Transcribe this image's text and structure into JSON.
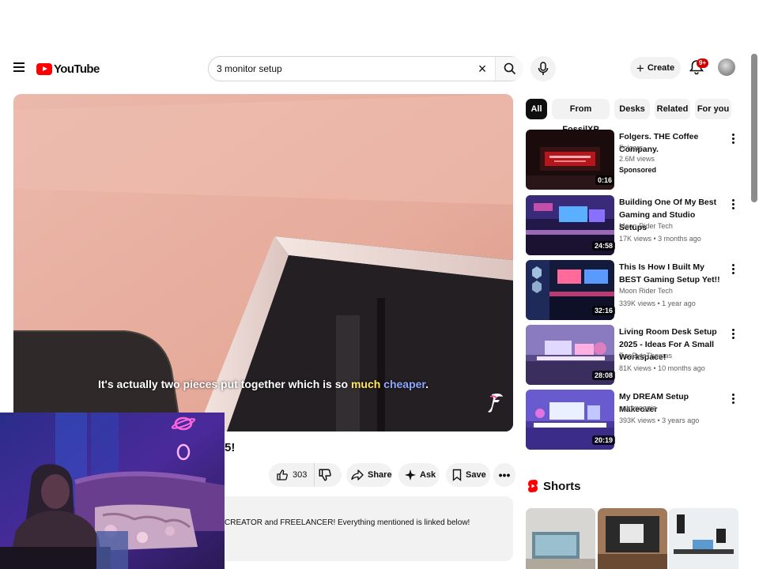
{
  "header": {
    "logo_text": "YouTube",
    "search_value": "3 monitor setup",
    "create_label": "Create",
    "notification_count": "9+"
  },
  "player": {
    "caption_parts": [
      "It's actually two pieces put together which is so ",
      "much",
      " ",
      "cheaper",
      "."
    ]
  },
  "video": {
    "title_fragment": "5!",
    "like_count": "303",
    "share_label": "Share",
    "ask_label": "Ask",
    "save_label": "Save",
    "description": "CREATOR and FREELANCER! Everything mentioned is linked below!"
  },
  "chips": [
    "All",
    "From FossilXP",
    "Desks",
    "Related",
    "For you"
  ],
  "recommendations": [
    {
      "title": "Folgers. THE Coffee Company.",
      "channel": "Folgers",
      "meta": "2.6M views",
      "badge": "Sponsored",
      "duration": "0:16"
    },
    {
      "title": "Building One Of My Best Gaming and Studio Setups",
      "channel": "Moon Rider Tech",
      "meta": "17K views • 3 months ago",
      "duration": "24:58"
    },
    {
      "title": "This Is How I Built My BEST Gaming Setup Yet!!",
      "channel": "Moon Rider Tech",
      "meta": "339K views • 1 year ago",
      "duration": "32:16"
    },
    {
      "title": "Living Room Desk Setup 2025 - Ideas For A Small Workspace!",
      "channel": "TwoByteThomas",
      "meta": "81K views • 10 months ago",
      "duration": "28:08"
    },
    {
      "title": "My DREAM Setup Makeover",
      "channel": "astronoggie",
      "meta": "393K views • 3 years ago",
      "duration": "20:19"
    }
  ],
  "shorts": {
    "heading": "Shorts"
  }
}
